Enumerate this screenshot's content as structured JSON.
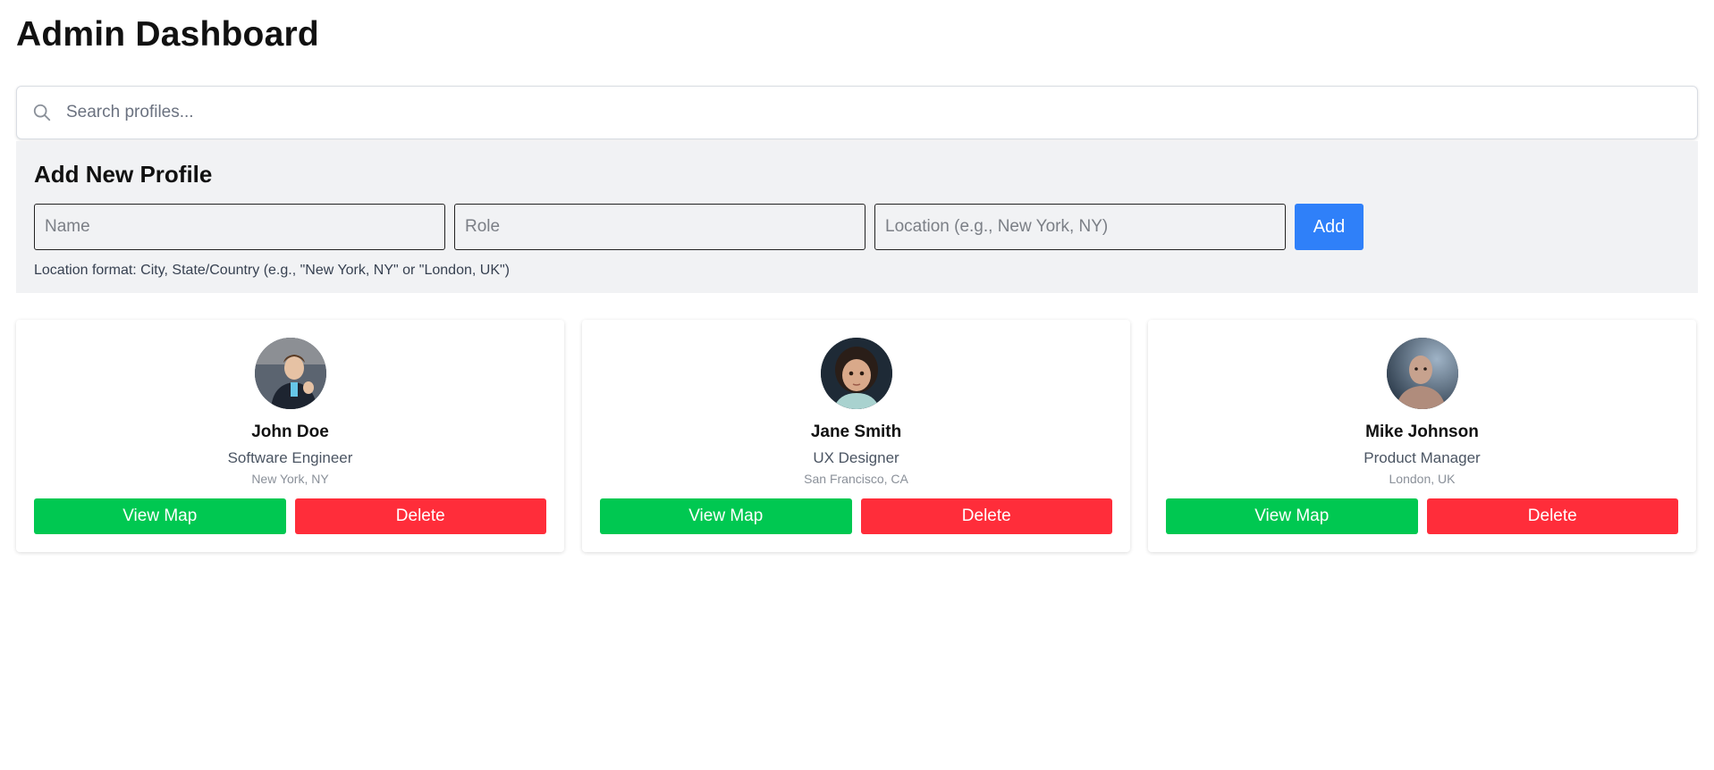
{
  "header": {
    "title": "Admin Dashboard"
  },
  "search": {
    "icon": "search-icon",
    "placeholder": "Search profiles...",
    "value": ""
  },
  "add_form": {
    "title": "Add New Profile",
    "name_placeholder": "Name",
    "role_placeholder": "Role",
    "location_placeholder": "Location (e.g., New York, NY)",
    "add_label": "Add",
    "hint": "Location format: City, State/Country (e.g., \"New York, NY\" or \"London, UK\")"
  },
  "profiles": [
    {
      "name": "John Doe",
      "role": "Software Engineer",
      "location": "New York, NY",
      "view_map_label": "View Map",
      "delete_label": "Delete"
    },
    {
      "name": "Jane Smith",
      "role": "UX Designer",
      "location": "San Francisco, CA",
      "view_map_label": "View Map",
      "delete_label": "Delete"
    },
    {
      "name": "Mike Johnson",
      "role": "Product Manager",
      "location": "London, UK",
      "view_map_label": "View Map",
      "delete_label": "Delete"
    }
  ],
  "colors": {
    "primary": "#2f80f9",
    "success": "#00c851",
    "danger": "#ff2d3a",
    "panel_bg": "#f1f2f4"
  }
}
